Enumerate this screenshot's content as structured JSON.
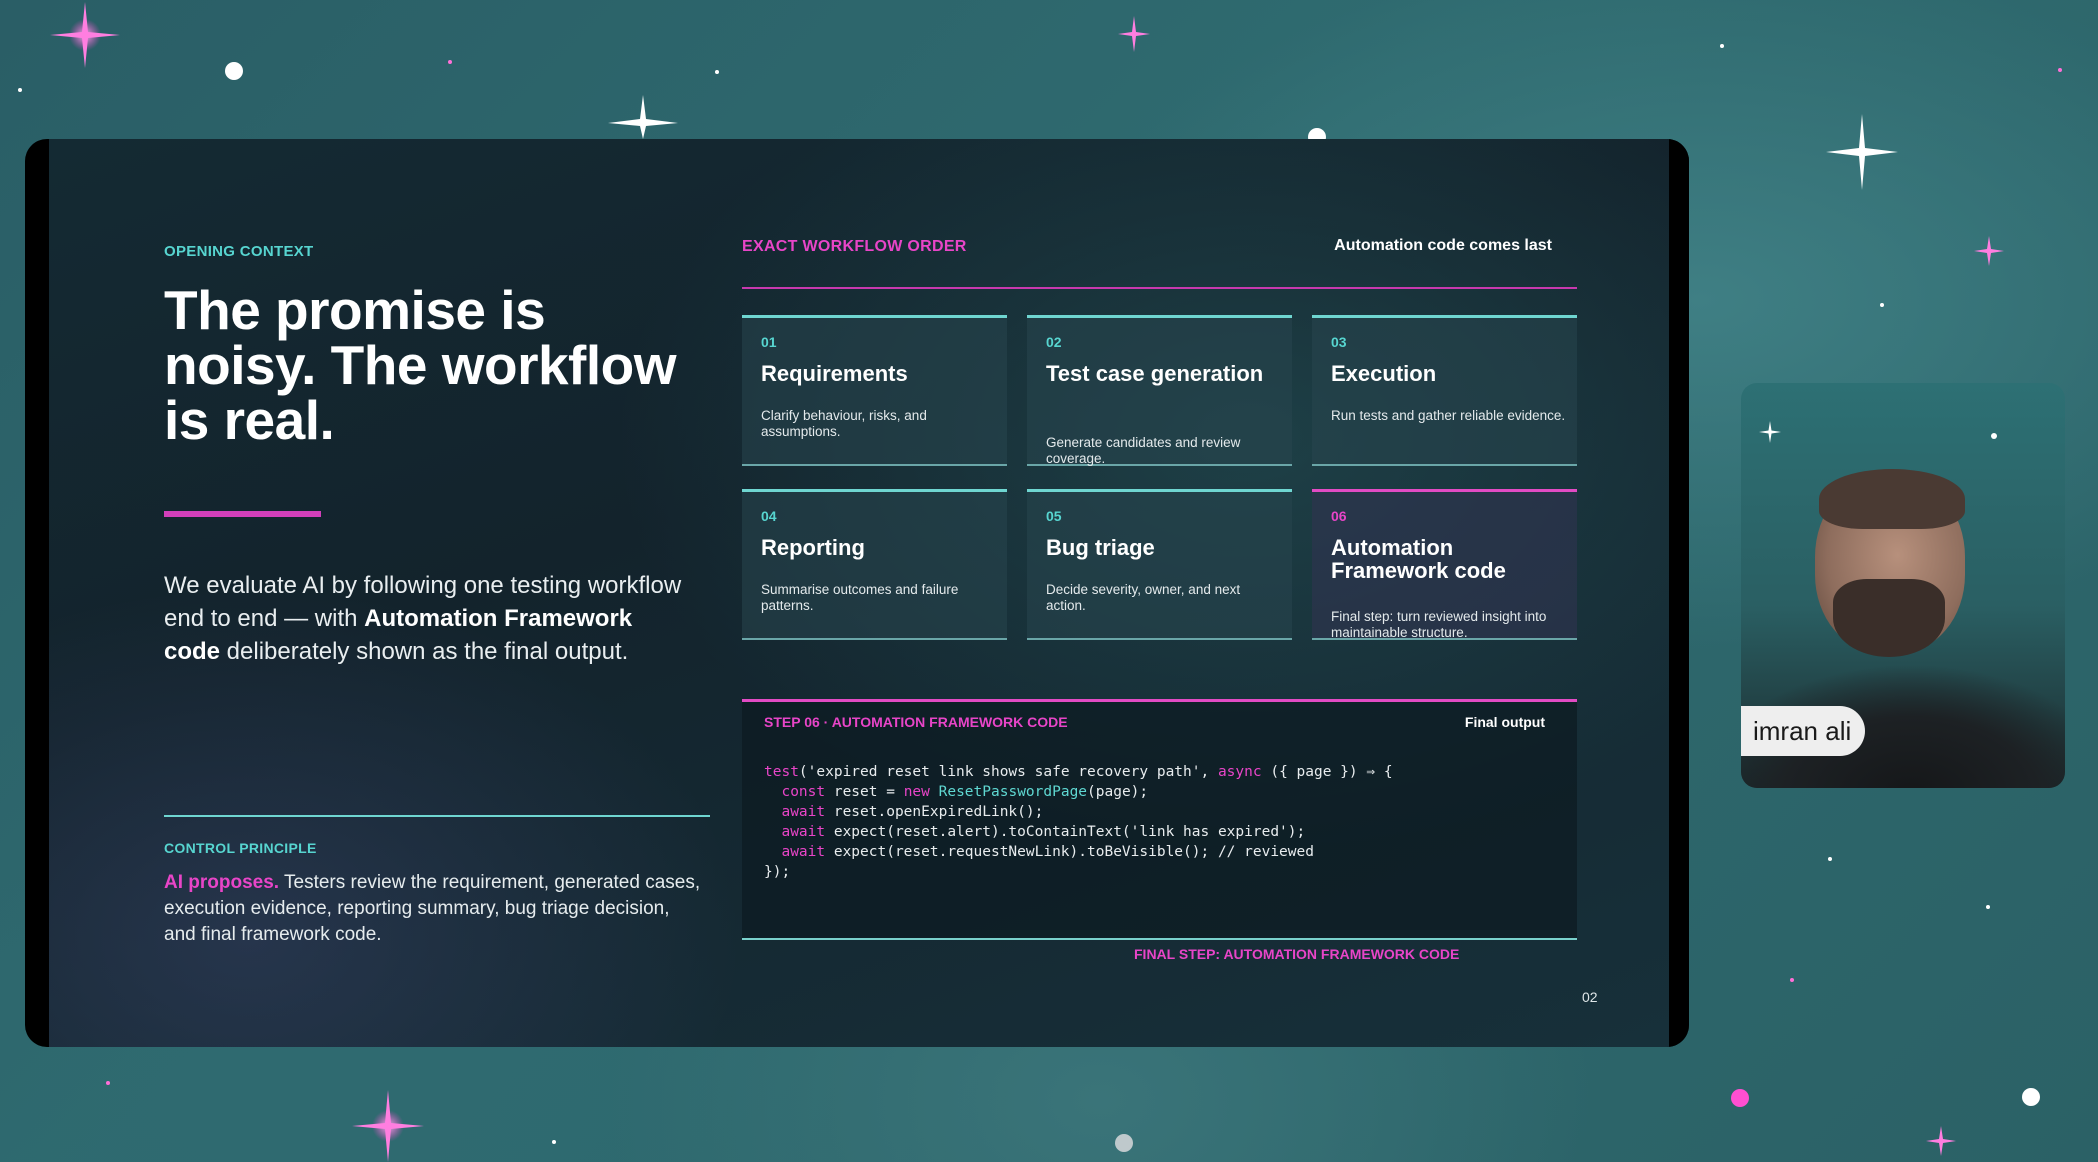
{
  "slide": {
    "left": {
      "eyebrow": "OPENING CONTEXT",
      "title": "The promise is noisy. The workflow is real.",
      "lead_parts": [
        "We evaluate AI by following one testing workflow end to end — with ",
        "Automation Framework code",
        " deliberately shown as the final output."
      ],
      "control_principle_label": "CONTROL PRINCIPLE",
      "control_principle_lead": "AI proposes.",
      "control_principle_text": " Testers review the requirement, generated cases, execution evidence, reporting summary, bug triage decision, and final framework code."
    },
    "workflow": {
      "eyebrow": "EXACT WORKFLOW ORDER",
      "subtitle": "Automation code comes last",
      "steps": [
        {
          "num": "01",
          "title": "Requirements",
          "desc": "Clarify behaviour, risks, and assumptions."
        },
        {
          "num": "02",
          "title": "Test case generation",
          "desc": "Generate candidates and review coverage."
        },
        {
          "num": "03",
          "title": "Execution",
          "desc": "Run tests and gather reliable evidence."
        },
        {
          "num": "04",
          "title": "Reporting",
          "desc": "Summarise outcomes and failure patterns."
        },
        {
          "num": "05",
          "title": "Bug triage",
          "desc": "Decide severity, owner, and next action."
        },
        {
          "num": "06",
          "title": "Automation Framework code",
          "desc": "Final step: turn reviewed insight into maintainable structure."
        }
      ]
    },
    "code_panel": {
      "heading": "STEP 06 · AUTOMATION FRAMEWORK CODE",
      "badge": "Final output",
      "lines": {
        "l1_kw": "test",
        "l1_a": "('expired reset link shows safe recovery path', ",
        "l1_kw2": "async",
        "l1_b": " ({ page }) ⇒ {",
        "l2_kw": "  const",
        "l2_a": " reset = ",
        "l2_kw2": "new",
        "l2_cls": " ResetPasswordPage",
        "l2_b": "(page);",
        "l3_kw": "  await",
        "l3_a": " reset.openExpiredLink();",
        "l4_kw": "  await",
        "l4_a": " expect(reset.alert).toContainText('link has expired');",
        "l5_kw": "  await",
        "l5_a": " expect(reset.requestNewLink).toBeVisible(); // reviewed",
        "l6": "});"
      }
    },
    "final_step": "FINAL STEP: AUTOMATION FRAMEWORK CODE",
    "page_number": "02"
  },
  "participant": {
    "name": "imran ali"
  },
  "colors": {
    "accent_pink": "#e845c8",
    "accent_cyan": "#57d5d0",
    "background": "#2c6167"
  }
}
